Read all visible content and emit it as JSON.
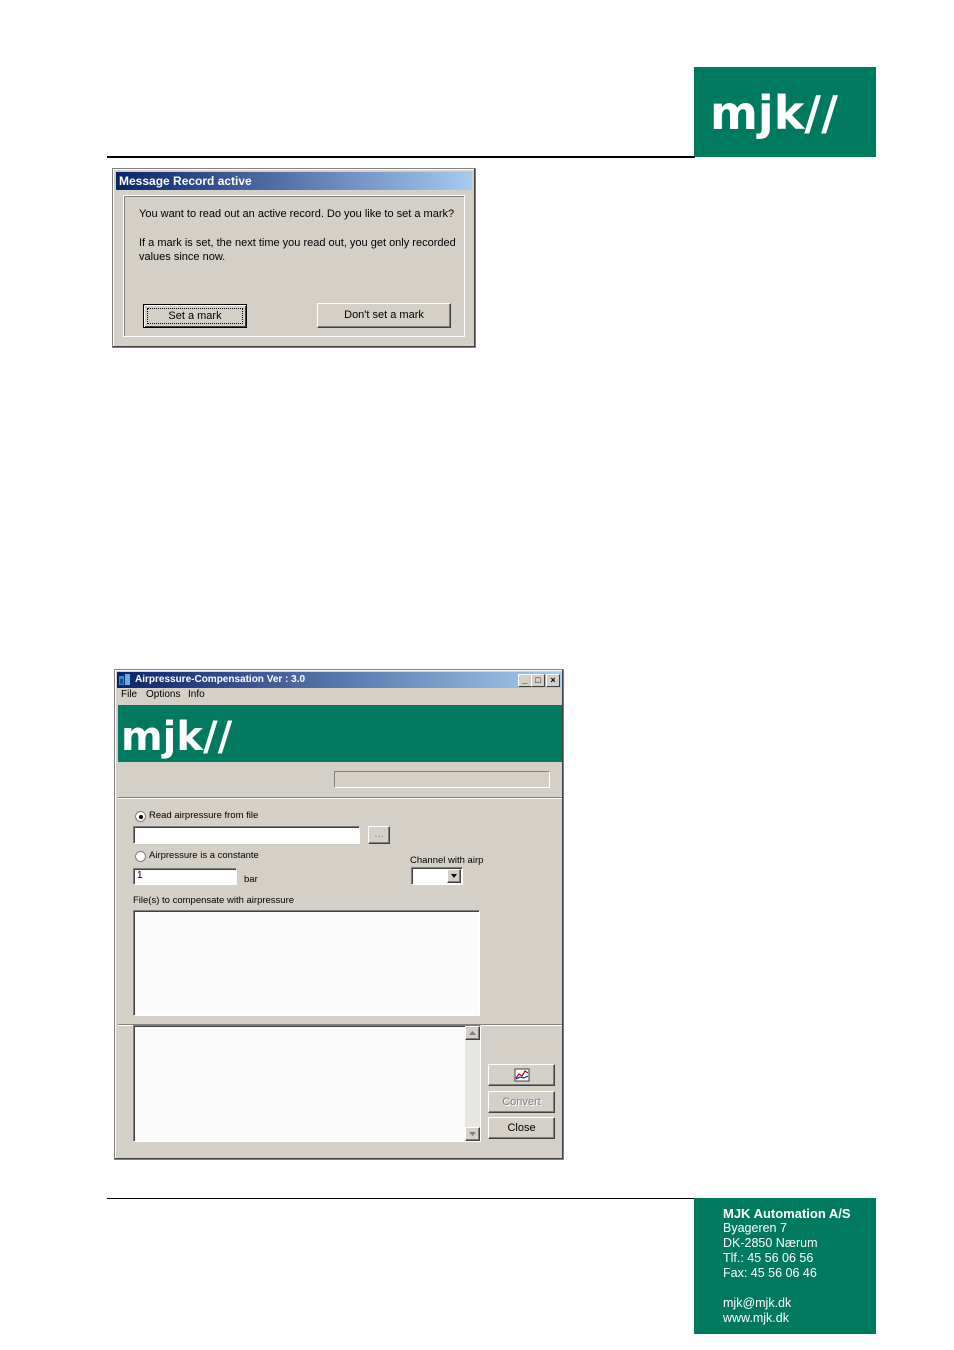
{
  "header": {
    "logo_text": "mjk//"
  },
  "dialog": {
    "title": "Message Record active",
    "question": "You want to read out an active record. Do you like to set a mark?",
    "explanation": "If a mark is set, the next time you read out, you get only recorded values since now.",
    "set_mark_label": "Set a mark",
    "dont_set_mark_label": "Don't set a mark"
  },
  "app": {
    "title": "Airpressure-Compensation Ver : 3.0",
    "menu": [
      "File",
      "Options",
      "Info"
    ],
    "banner_logo_text": "mjk//",
    "read_from_file_label": "Read airpressure from file",
    "read_from_file_selected": true,
    "browse_label": "...",
    "constant_label": "Airpressure is a constante",
    "constant_value": "1",
    "unit_label": "bar",
    "channel_label": "Channel with airp",
    "files_label": "File(s) to compensate with airpressure",
    "convert_label": "Convert",
    "close_label": "Close",
    "graph_button_icon": "graph-icon"
  },
  "footer": {
    "company": "MJK Automation A/S",
    "street": "Byageren 7",
    "city": "DK-2850 Nærum",
    "phone": "Tlf.:  45 56 06 56",
    "fax": "Fax:  45 56 06 46",
    "email": "mjk@mjk.dk",
    "web": "www.mjk.dk"
  },
  "colors": {
    "brand_green": "#007a5e",
    "titlebar_start": "#0a246a",
    "titlebar_end": "#a6caf0",
    "window_gray": "#d4d0c8"
  }
}
